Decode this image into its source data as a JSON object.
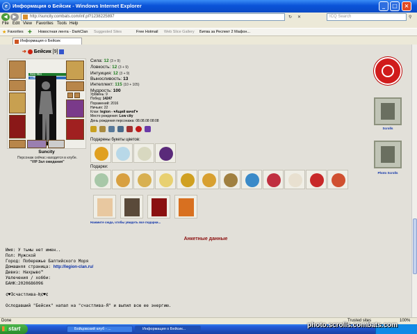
{
  "window": {
    "title": "Информация о Бейсик - Windows Internet Explorer"
  },
  "address": {
    "url": "http://suncity.combats.com/inf.pl?1238225897",
    "search_placeholder": "ICQ Search"
  },
  "menu": [
    "File",
    "Edit",
    "View",
    "Favorites",
    "Tools",
    "Help"
  ],
  "favbar": {
    "favorites": "Favorites",
    "items": [
      "Новостная лента - DarkClan",
      "Suggested Sites",
      "Free Hotmail",
      "Web Slice Gallery",
      "Битва за Респект 2 Мафон..."
    ]
  },
  "tab": {
    "label": "Информация о Бейсик"
  },
  "profile": {
    "nick": "Бейсик",
    "level": "[9]",
    "hp": "984/984",
    "mana": "1200/1200",
    "city": "Suncity",
    "location_line": "Персонаж сейчас находится в клубе.",
    "location_room": "\"VIP Зал ожидания\"",
    "stats": [
      {
        "label": "Сила:",
        "value": "12",
        "sub": "(3 + 9)"
      },
      {
        "label": "Ловкость:",
        "value": "12",
        "sub": "(3 + 9)"
      },
      {
        "label": "Интуиция:",
        "value": "12",
        "sub": "(3 + 9)"
      },
      {
        "label": "Выносливость:",
        "value": "13",
        "sub": ""
      },
      {
        "label": "Интеллект:",
        "value": "115",
        "sub": "(10 + 105)"
      },
      {
        "label": "Мудрость:",
        "value": "100",
        "sub": ""
      }
    ],
    "info": [
      {
        "label": "Уровень:",
        "value": "9"
      },
      {
        "label": "Побед:",
        "value": "14247"
      },
      {
        "label": "Поражений:",
        "value": "2016"
      },
      {
        "label": "Ничьих:",
        "value": "22"
      },
      {
        "label": "Клан:",
        "value": "legion - ♥Ащий качоГ♥"
      },
      {
        "label": "Место рождения:",
        "value": "Low city"
      },
      {
        "label": "День рождения персонажа:",
        "value": "08.08.08 08:08"
      }
    ],
    "flowers_label": "Подарены букеты цветов:",
    "gifts_label": "Подарки:",
    "more_gifts_link": "Нажмите сюда, чтобы увидеть все подарки..."
  },
  "sidebar_logos": [
    {
      "label": "Scrolls"
    },
    {
      "label": "Photo Scrolls"
    }
  ],
  "anketa": {
    "title": "Анкетные данные",
    "lines": [
      "Имя: У тьмы нет имен..",
      "Пол: Мужской",
      "Город: Побережье Балтийского Моря"
    ],
    "homepage_label": "Домашняя страница: ",
    "homepage_link": "http://legion-clan.ru/",
    "lines2": [
      "Девиз: Нахрыво™",
      "Увлечения / хобби:",
      "БАНК:2020686096"
    ],
    "quote": "¢♥Ǝсчастлива-Ʀ¢♥¢",
    "event": "Ослодавший \"Бейсик\" напал на \"счастлива-Я\" и выпил всю ее энергию."
  },
  "statusbar": {
    "left": "Done",
    "right": "Trusted sites",
    "zoom": "100%"
  },
  "taskbar": {
    "start": "start",
    "tasks": [
      "Бойцовский клуб - ...",
      "Информация о Бейсик..."
    ]
  },
  "watermark": "photo.scrolls.combats.com",
  "colors": {
    "accent": "#1e7b1e",
    "link": "#0a2fa8",
    "heading": "#8a0c0c"
  }
}
